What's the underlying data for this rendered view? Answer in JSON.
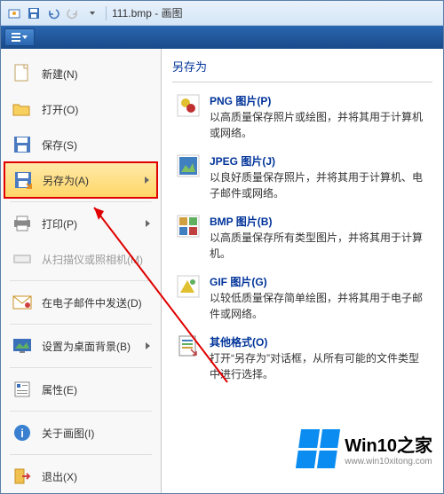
{
  "titlebar": {
    "filename": "111.bmp",
    "appname": "画图",
    "sep": " - "
  },
  "menu": {
    "new": "新建(N)",
    "open": "打开(O)",
    "save": "保存(S)",
    "saveas": "另存为(A)",
    "print": "打印(P)",
    "scanner": "从扫描仪或照相机(M)",
    "email": "在电子邮件中发送(D)",
    "wallpaper": "设置为桌面背景(B)",
    "properties": "属性(E)",
    "about": "关于画图(I)",
    "exit": "退出(X)"
  },
  "right": {
    "title": "另存为",
    "png": {
      "title": "PNG 图片(P)",
      "desc": "以高质量保存照片或绘图，并将其用于计算机或网络。"
    },
    "jpeg": {
      "title": "JPEG 图片(J)",
      "desc": "以良好质量保存照片，并将其用于计算机、电子邮件或网络。"
    },
    "bmp": {
      "title": "BMP 图片(B)",
      "desc": "以高质量保存所有类型图片，并将其用于计算机。"
    },
    "gif": {
      "title": "GIF 图片(G)",
      "desc": "以较低质量保存简单绘图，并将其用于电子邮件或网络。"
    },
    "other": {
      "title": "其他格式(O)",
      "desc": "打开“另存为”对话框，从所有可能的文件类型中进行选择。"
    }
  },
  "watermark": {
    "main": "Win10之家",
    "sub": "www.win10xitong.com"
  }
}
